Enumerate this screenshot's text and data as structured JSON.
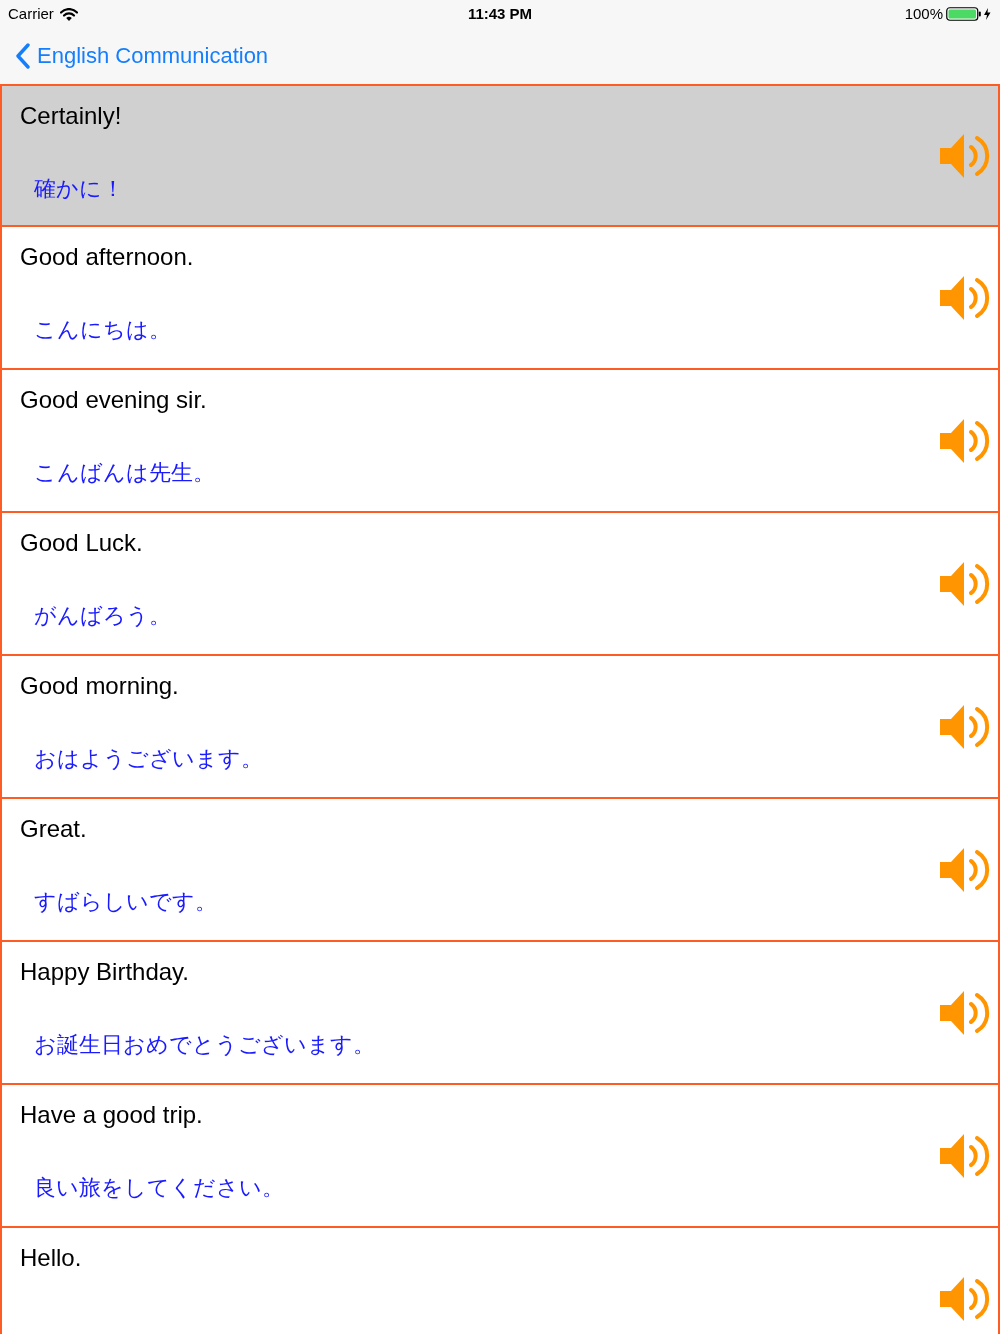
{
  "status_bar": {
    "carrier": "Carrier",
    "time": "11:43 PM",
    "battery": "100%"
  },
  "nav_bar": {
    "back_label": "English Communication"
  },
  "rows": [
    {
      "english": "Certainly!",
      "japanese": "確かに！",
      "selected": true
    },
    {
      "english": "Good afternoon.",
      "japanese": "こんにちは。",
      "selected": false
    },
    {
      "english": "Good evening sir.",
      "japanese": "こんばんは先生。",
      "selected": false
    },
    {
      "english": "Good Luck.",
      "japanese": "がんばろう。",
      "selected": false
    },
    {
      "english": "Good morning.",
      "japanese": "おはようございます。",
      "selected": false
    },
    {
      "english": "Great.",
      "japanese": "すばらしいです。",
      "selected": false
    },
    {
      "english": "Happy Birthday.",
      "japanese": "お誕生日おめでとうございます。",
      "selected": false
    },
    {
      "english": "Have a good trip.",
      "japanese": "良い旅をしてください。",
      "selected": false
    },
    {
      "english": "Hello.",
      "selected": false
    }
  ]
}
